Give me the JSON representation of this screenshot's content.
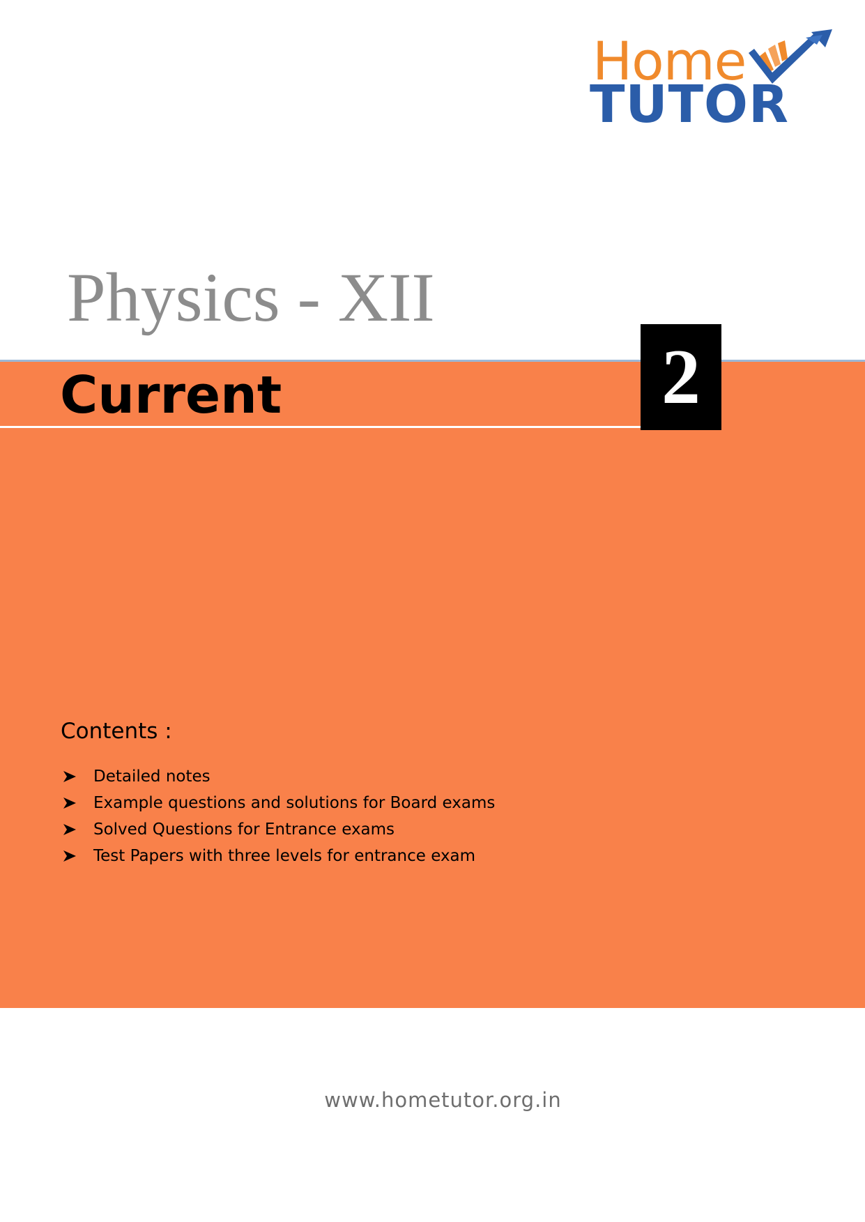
{
  "logo": {
    "word_top": "Home",
    "word_bottom": "TUTOR",
    "icon": "checkmark-arrow-icon",
    "colors": {
      "home": "#f08a2c",
      "tutor": "#2b5da9"
    }
  },
  "title": "Physics - XII",
  "chapter": {
    "name": "Current",
    "number": "2"
  },
  "contents": {
    "heading": "Contents :",
    "bullet_icon": "arrowhead-bullet-icon",
    "items": [
      {
        "label": "Detailed notes"
      },
      {
        "label": "Example questions and solutions for Board exams"
      },
      {
        "label": "Solved Questions for Entrance exams"
      },
      {
        "label": "Test Papers with three levels for entrance exam"
      }
    ]
  },
  "footer": {
    "url": "www.hometutor.org.in"
  },
  "colors": {
    "accent_orange": "#f9814a",
    "title_gray": "#8c8c8c",
    "rule_blue": "#9cb8d6"
  }
}
